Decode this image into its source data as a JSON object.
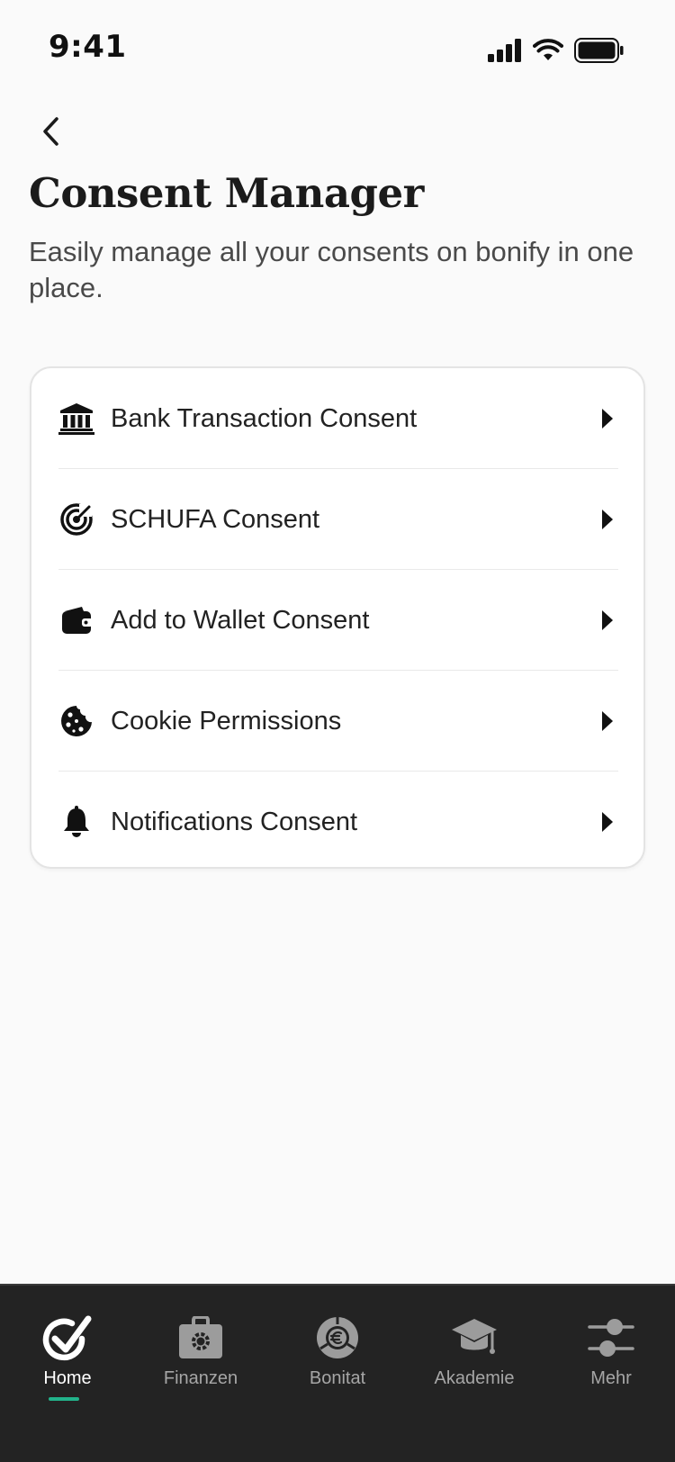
{
  "status_bar": {
    "time": "9:41",
    "icons": [
      "cellular-signal-icon",
      "wifi-icon",
      "battery-icon"
    ]
  },
  "header": {
    "back_icon": "chevron-left-icon",
    "title": "Consent Manager",
    "subtitle": "Easily manage all your consents on bonify in one place."
  },
  "consents": [
    {
      "label": "Bank Transaction Consent",
      "icon": "bank-icon"
    },
    {
      "label": "SCHUFA Consent",
      "icon": "target-icon"
    },
    {
      "label": "Add to Wallet Consent",
      "icon": "wallet-icon"
    },
    {
      "label": "Cookie Permissions",
      "icon": "cookie-icon"
    },
    {
      "label": "Notifications Consent",
      "icon": "bell-icon"
    }
  ],
  "tab_bar": {
    "active_index": 0,
    "accent_color": "#22b38b",
    "tabs": [
      {
        "label": "Home",
        "icon": "checkmark-circle-icon"
      },
      {
        "label": "Finanzen",
        "icon": "briefcase-gear-icon"
      },
      {
        "label": "Bonitat",
        "icon": "euro-gauge-icon"
      },
      {
        "label": "Akademie",
        "icon": "graduation-cap-icon"
      },
      {
        "label": "Mehr",
        "icon": "sliders-icon"
      }
    ]
  }
}
